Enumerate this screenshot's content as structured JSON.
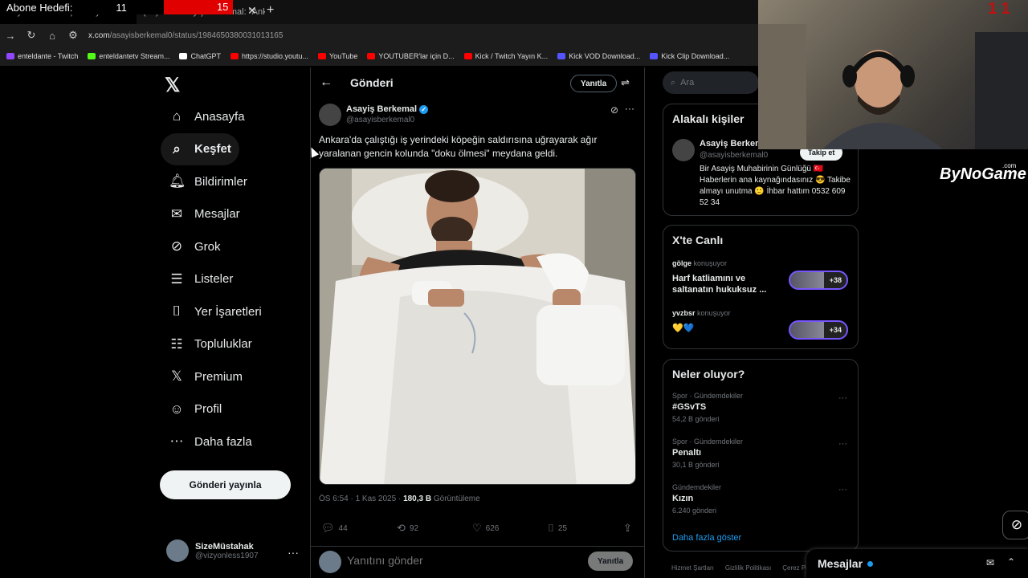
{
  "stream": {
    "goal_label": "Abone Hedefi:",
    "current": "11",
    "target": "15",
    "webcam_counter": "1 1",
    "brand": "ByNoGame",
    "brand_suffix": ".com"
  },
  "browser": {
    "tab1": "Sayaclik Rutten | Huseyin B...",
    "tab2": "(47) X'te Asayiş Berkemal: \"Ankara...",
    "url_main": "x.com",
    "url_path": "/asayisberkemal0/status/1984650380031013165",
    "bookmarks": [
      "enteldante - Twitch",
      "enteldantetv Stream...",
      "ChatGPT",
      "https://studio.youtu...",
      "YouTube",
      "YOUTUBER'lar için D...",
      "Kick / Twitch Yayın K...",
      "Kick VOD Download...",
      "Kick Clip Download..."
    ]
  },
  "nav": {
    "items": [
      {
        "label": "Anasayfa",
        "icon": "home-icon"
      },
      {
        "label": "Keşfet",
        "icon": "search-icon"
      },
      {
        "label": "Bildirimler",
        "icon": "bell-icon"
      },
      {
        "label": "Mesajlar",
        "icon": "mail-icon"
      },
      {
        "label": "Grok",
        "icon": "grok-icon"
      },
      {
        "label": "Listeler",
        "icon": "list-icon"
      },
      {
        "label": "Yer İşaretleri",
        "icon": "bookmark-icon"
      },
      {
        "label": "Topluluklar",
        "icon": "communities-icon"
      },
      {
        "label": "Premium",
        "icon": "x-premium-icon"
      },
      {
        "label": "Profil",
        "icon": "profile-icon"
      },
      {
        "label": "Daha fazla",
        "icon": "more-icon"
      }
    ],
    "post_button": "Gönderi yayınla",
    "user_name": "SizeMüstahak",
    "user_handle": "@vizyonless1907"
  },
  "post": {
    "header_title": "Gönderi",
    "reply_top": "Yanıtla",
    "author": "Asayiş Berkemal",
    "handle": "@asayisberkemal0",
    "text": "Ankara'da çalıştığı iş yerindeki köpeğin saldırısına uğrayarak ağır yaralanan gencin kolunda \"doku ölmesi\" meydana geldi.",
    "time": "ÖS 6:54 · 1 Kas 2025 · ",
    "views": "180,3 B",
    "views_label": " Görüntüleme",
    "replies": "44",
    "reposts": "92",
    "likes": "626",
    "bookmarks": "25",
    "reply_placeholder": "Yanıtını gönder",
    "reply_button": "Yanıtla"
  },
  "right": {
    "search_placeholder": "Ara",
    "related_title": "Alakalı kişiler",
    "related_name": "Asayiş Berkem",
    "related_handle": "@asayisberkemal0",
    "follow": "Takip et",
    "related_bio": "Bir Asayiş Muhabirinin Günlüğü 🇹🇷 Haberlerin ana kaynağındasınız 😎 Takibe almayı unutma 🙂 İhbar hattım 0532 609 52 34",
    "live_title": "X'te Canlı",
    "live": [
      {
        "host": "gölge",
        "status": "konuşuyor",
        "title": "Harf katliamını ve saltanatın hukuksuz ...",
        "count": "+38"
      },
      {
        "host": "yvzbsr",
        "status": "konuşuyor",
        "title": "💛💙",
        "count": "+34"
      }
    ],
    "trends_title": "Neler oluyor?",
    "trends": [
      {
        "meta": "Spor · Gündemdekiler",
        "name": "#GSvTS",
        "count": "54,2 B gönderi"
      },
      {
        "meta": "Spor · Gündemdekiler",
        "name": "Penaltı",
        "count": "30,1 B gönderi"
      },
      {
        "meta": "Gündemdekiler",
        "name": "Kızın",
        "count": "6.240 gönderi"
      }
    ],
    "show_more": "Daha fazla göster",
    "footer": [
      "Hizmet Şartları",
      "Gizlilik Politikası",
      "Çerez Po"
    ]
  },
  "dock": {
    "messages": "Mesajlar"
  }
}
